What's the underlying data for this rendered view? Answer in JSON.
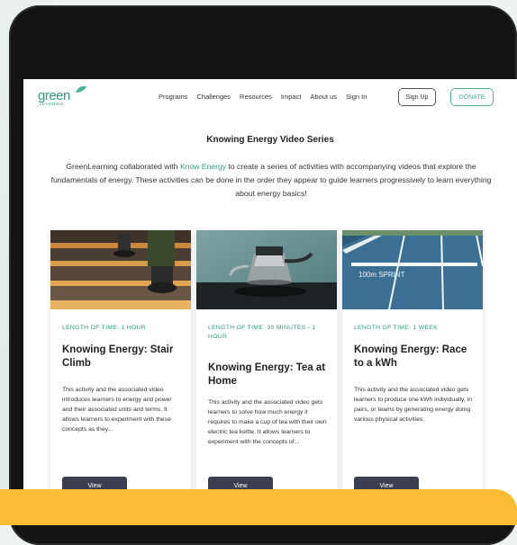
{
  "nav": {
    "logo_text": "green",
    "logo_sub": "LEARNING",
    "links": [
      "Programs",
      "Challenges",
      "Resources",
      "Impact",
      "About us",
      "Sign In"
    ],
    "signup_label": "Sign Up",
    "donate_label": "DONATE"
  },
  "page": {
    "title": "Knowing Energy Video Series",
    "intro_before": "GreenLearning collaborated with ",
    "intro_link": "Know Energy",
    "intro_after": " to create a series of activities with accompanying videos that explore the fundamentals of energy. These activities can be done in the order they appear to guide learners progressively to learn everything about energy basics!"
  },
  "cards": [
    {
      "time": "LENGTH OF TIME: 1 HOUR",
      "title": "Knowing Energy: Stair Climb",
      "desc": "This activity and the associated video introduces learners to energy and power and their associated units and terms. It allows learners to experiment with these concepts as they...",
      "button": "View",
      "image": "stairs-photo"
    },
    {
      "time": "LENGTH OF TIME: 30 MINUTES - 1 HOUR",
      "title": "Knowing Energy: Tea at Home",
      "desc": "This activity and the associated video gets learners to solve how much energy it requires to make a cup of tea with their own electric tea kettle. It allows learners to experiment with the concepts of...",
      "button": "View",
      "image": "kettle-photo"
    },
    {
      "time": "LENGTH OF TIME: 1 WEEK",
      "title": "Knowing Energy: Race to a kWh",
      "desc": "This activity and the associated video gets learners to produce one kWh individually, in pairs, or teams by generating energy doing various physical activities.",
      "button": "View",
      "image": "running-track-photo",
      "track_text": "100m SPRINT"
    }
  ],
  "colors": {
    "accent": "#2e9b7f",
    "button_dark": "#3c3e52",
    "banner": "#fcbc34",
    "tablet": "#141414"
  }
}
